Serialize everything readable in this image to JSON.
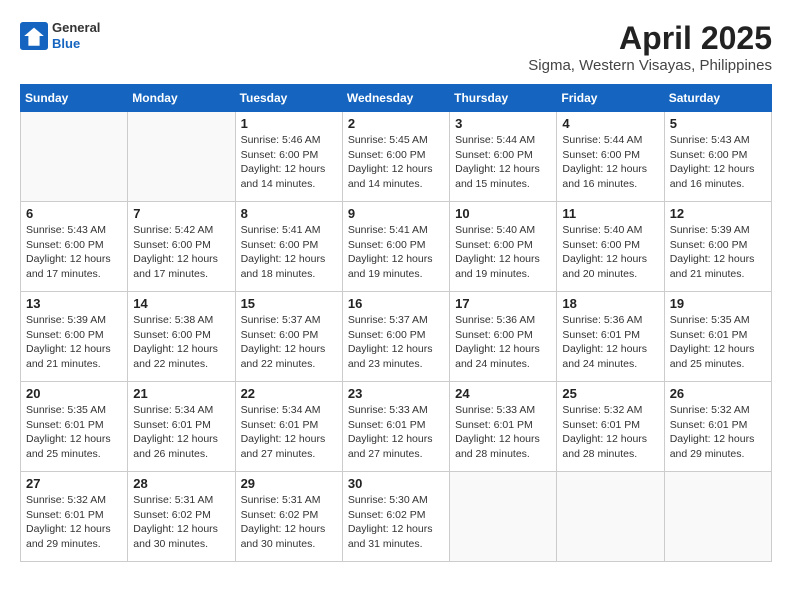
{
  "header": {
    "logo_line1": "General",
    "logo_line2": "Blue",
    "title": "April 2025",
    "subtitle": "Sigma, Western Visayas, Philippines"
  },
  "weekdays": [
    "Sunday",
    "Monday",
    "Tuesday",
    "Wednesday",
    "Thursday",
    "Friday",
    "Saturday"
  ],
  "weeks": [
    [
      {
        "day": "",
        "detail": ""
      },
      {
        "day": "",
        "detail": ""
      },
      {
        "day": "1",
        "detail": "Sunrise: 5:46 AM\nSunset: 6:00 PM\nDaylight: 12 hours\nand 14 minutes."
      },
      {
        "day": "2",
        "detail": "Sunrise: 5:45 AM\nSunset: 6:00 PM\nDaylight: 12 hours\nand 14 minutes."
      },
      {
        "day": "3",
        "detail": "Sunrise: 5:44 AM\nSunset: 6:00 PM\nDaylight: 12 hours\nand 15 minutes."
      },
      {
        "day": "4",
        "detail": "Sunrise: 5:44 AM\nSunset: 6:00 PM\nDaylight: 12 hours\nand 16 minutes."
      },
      {
        "day": "5",
        "detail": "Sunrise: 5:43 AM\nSunset: 6:00 PM\nDaylight: 12 hours\nand 16 minutes."
      }
    ],
    [
      {
        "day": "6",
        "detail": "Sunrise: 5:43 AM\nSunset: 6:00 PM\nDaylight: 12 hours\nand 17 minutes."
      },
      {
        "day": "7",
        "detail": "Sunrise: 5:42 AM\nSunset: 6:00 PM\nDaylight: 12 hours\nand 17 minutes."
      },
      {
        "day": "8",
        "detail": "Sunrise: 5:41 AM\nSunset: 6:00 PM\nDaylight: 12 hours\nand 18 minutes."
      },
      {
        "day": "9",
        "detail": "Sunrise: 5:41 AM\nSunset: 6:00 PM\nDaylight: 12 hours\nand 19 minutes."
      },
      {
        "day": "10",
        "detail": "Sunrise: 5:40 AM\nSunset: 6:00 PM\nDaylight: 12 hours\nand 19 minutes."
      },
      {
        "day": "11",
        "detail": "Sunrise: 5:40 AM\nSunset: 6:00 PM\nDaylight: 12 hours\nand 20 minutes."
      },
      {
        "day": "12",
        "detail": "Sunrise: 5:39 AM\nSunset: 6:00 PM\nDaylight: 12 hours\nand 21 minutes."
      }
    ],
    [
      {
        "day": "13",
        "detail": "Sunrise: 5:39 AM\nSunset: 6:00 PM\nDaylight: 12 hours\nand 21 minutes."
      },
      {
        "day": "14",
        "detail": "Sunrise: 5:38 AM\nSunset: 6:00 PM\nDaylight: 12 hours\nand 22 minutes."
      },
      {
        "day": "15",
        "detail": "Sunrise: 5:37 AM\nSunset: 6:00 PM\nDaylight: 12 hours\nand 22 minutes."
      },
      {
        "day": "16",
        "detail": "Sunrise: 5:37 AM\nSunset: 6:00 PM\nDaylight: 12 hours\nand 23 minutes."
      },
      {
        "day": "17",
        "detail": "Sunrise: 5:36 AM\nSunset: 6:00 PM\nDaylight: 12 hours\nand 24 minutes."
      },
      {
        "day": "18",
        "detail": "Sunrise: 5:36 AM\nSunset: 6:01 PM\nDaylight: 12 hours\nand 24 minutes."
      },
      {
        "day": "19",
        "detail": "Sunrise: 5:35 AM\nSunset: 6:01 PM\nDaylight: 12 hours\nand 25 minutes."
      }
    ],
    [
      {
        "day": "20",
        "detail": "Sunrise: 5:35 AM\nSunset: 6:01 PM\nDaylight: 12 hours\nand 25 minutes."
      },
      {
        "day": "21",
        "detail": "Sunrise: 5:34 AM\nSunset: 6:01 PM\nDaylight: 12 hours\nand 26 minutes."
      },
      {
        "day": "22",
        "detail": "Sunrise: 5:34 AM\nSunset: 6:01 PM\nDaylight: 12 hours\nand 27 minutes."
      },
      {
        "day": "23",
        "detail": "Sunrise: 5:33 AM\nSunset: 6:01 PM\nDaylight: 12 hours\nand 27 minutes."
      },
      {
        "day": "24",
        "detail": "Sunrise: 5:33 AM\nSunset: 6:01 PM\nDaylight: 12 hours\nand 28 minutes."
      },
      {
        "day": "25",
        "detail": "Sunrise: 5:32 AM\nSunset: 6:01 PM\nDaylight: 12 hours\nand 28 minutes."
      },
      {
        "day": "26",
        "detail": "Sunrise: 5:32 AM\nSunset: 6:01 PM\nDaylight: 12 hours\nand 29 minutes."
      }
    ],
    [
      {
        "day": "27",
        "detail": "Sunrise: 5:32 AM\nSunset: 6:01 PM\nDaylight: 12 hours\nand 29 minutes."
      },
      {
        "day": "28",
        "detail": "Sunrise: 5:31 AM\nSunset: 6:02 PM\nDaylight: 12 hours\nand 30 minutes."
      },
      {
        "day": "29",
        "detail": "Sunrise: 5:31 AM\nSunset: 6:02 PM\nDaylight: 12 hours\nand 30 minutes."
      },
      {
        "day": "30",
        "detail": "Sunrise: 5:30 AM\nSunset: 6:02 PM\nDaylight: 12 hours\nand 31 minutes."
      },
      {
        "day": "",
        "detail": ""
      },
      {
        "day": "",
        "detail": ""
      },
      {
        "day": "",
        "detail": ""
      }
    ]
  ]
}
